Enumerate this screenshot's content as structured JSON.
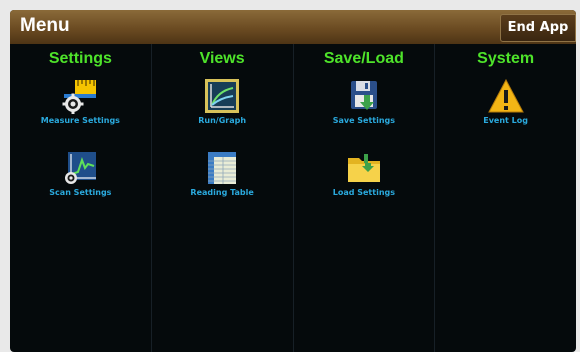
{
  "header": {
    "title": "Menu",
    "end_app_label": "End App"
  },
  "columns": [
    {
      "title": "Settings",
      "items": [
        {
          "label": "Measure Settings",
          "icon": "measure-settings-icon"
        },
        {
          "label": "Scan Settings",
          "icon": "scan-settings-icon"
        }
      ]
    },
    {
      "title": "Views",
      "items": [
        {
          "label": "Run/Graph",
          "icon": "graph-icon"
        },
        {
          "label": "Reading Table",
          "icon": "table-icon"
        }
      ]
    },
    {
      "title": "Save/Load",
      "items": [
        {
          "label": "Save Settings",
          "icon": "save-icon"
        },
        {
          "label": "Load Settings",
          "icon": "folder-icon"
        }
      ]
    },
    {
      "title": "System",
      "items": [
        {
          "label": "Event Log",
          "icon": "warning-icon"
        }
      ]
    }
  ],
  "colors": {
    "header_text": "#4ee32a",
    "label_text": "#2aa9dd",
    "background": "#050a0c",
    "titlebar": "#6b4b22"
  }
}
